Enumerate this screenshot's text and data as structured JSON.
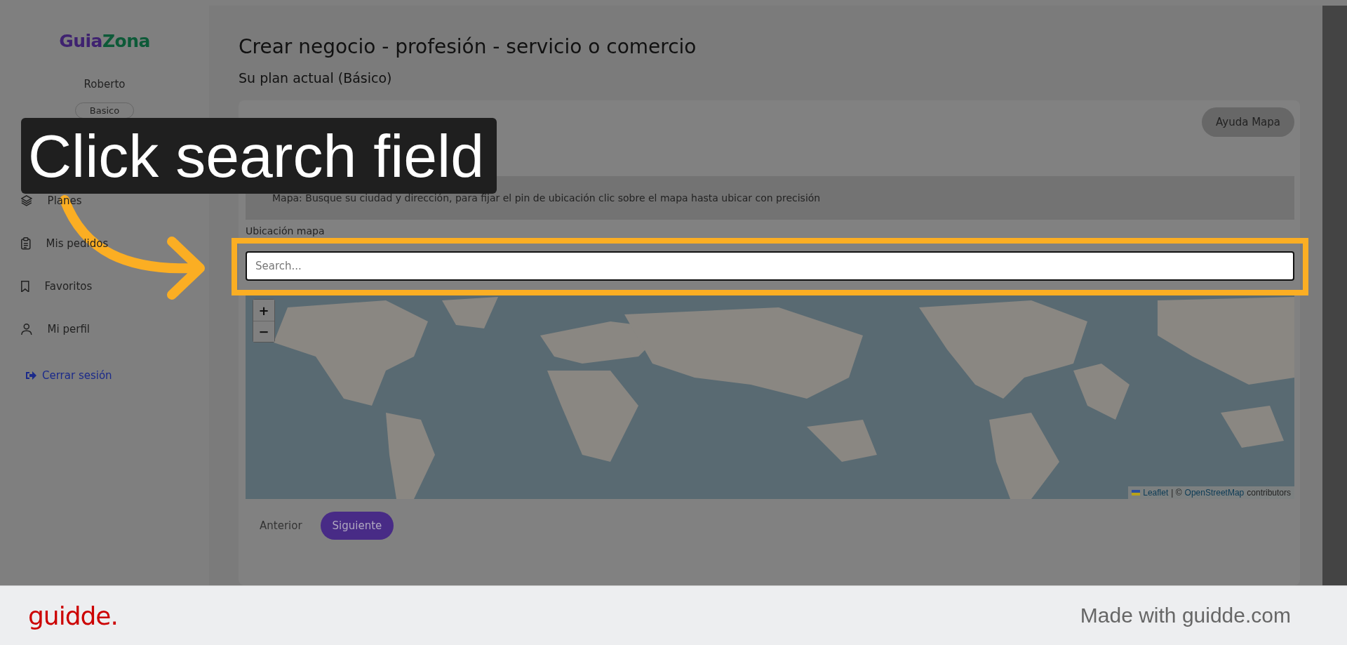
{
  "tutorial": {
    "callout": "Click search field"
  },
  "sidebar": {
    "logo": {
      "left": "Guia",
      "mark": "Z",
      "right": "ona"
    },
    "user_name": "Roberto",
    "plan_badge": "Basico",
    "items": [
      {
        "label": "Planes"
      },
      {
        "label": "Mis pedidos"
      },
      {
        "label": "Favoritos"
      },
      {
        "label": "Mi perfil"
      }
    ],
    "logout": "Cerrar sesión"
  },
  "main": {
    "title": "Crear negocio - profesión - servicio o comercio",
    "subtitle": "Su plan actual (Básico)",
    "help_button": "Ayuda Mapa",
    "info": "Mapa: Busque su ciudad y dirección, para fijar el pin de ubicación clic sobre el mapa hasta ubicar con precisión",
    "field_label": "Ubicación mapa",
    "search": {
      "placeholder": "Search..."
    },
    "map": {
      "zoom_in": "+",
      "zoom_out": "−",
      "attribution": {
        "link_1": "Leaflet",
        "separator": "| ©",
        "link_2": "OpenStreetMap",
        "suffix": "contributors"
      }
    },
    "prev_button": "Anterior",
    "next_button": "Siguiente"
  },
  "footer": {
    "brand": "guidde.",
    "credit": "Made with guidde.com"
  }
}
